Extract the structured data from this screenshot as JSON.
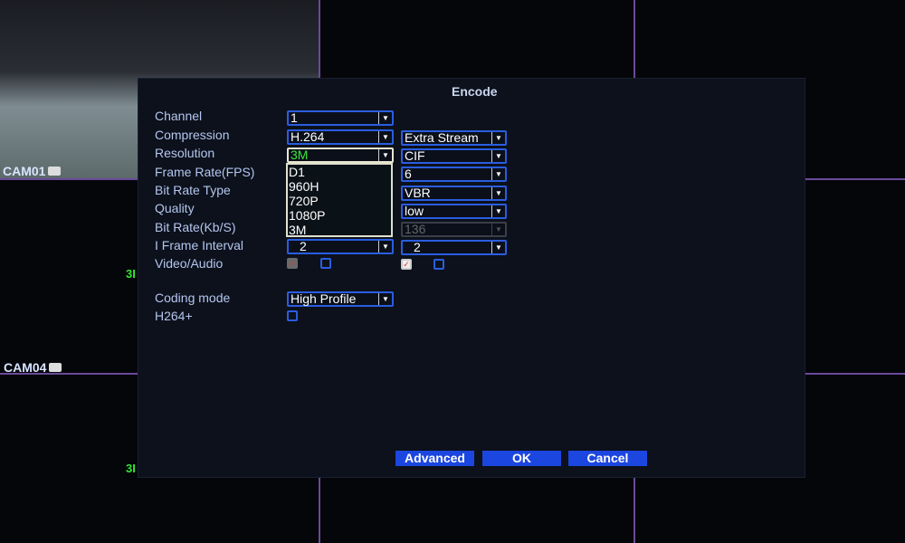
{
  "cameras": {
    "cam01": "CAM01",
    "cam04": "CAM04"
  },
  "fragments": {
    "a": "3I",
    "b": "3I"
  },
  "dialog": {
    "title": "Encode",
    "labels": [
      "Channel",
      "Compression",
      "Resolution",
      "Frame Rate(FPS)",
      "Bit Rate Type",
      "Quality",
      "Bit Rate(Kb/S)",
      "I Frame Interval",
      "Video/Audio",
      "Coding mode",
      "H264+"
    ],
    "main": {
      "channel": "1",
      "compression": "H.264",
      "resolution": "3M",
      "iframe": "2",
      "coding_mode": "High Profile",
      "video": true,
      "audio": false,
      "h264plus": false
    },
    "extra": {
      "stream": "Extra Stream",
      "resolution": "CIF",
      "fps": "6",
      "bitrate_type": "VBR",
      "quality": "low",
      "bitrate": "136",
      "iframe": "2",
      "video": true,
      "audio": false
    },
    "resolution_options": [
      "D1",
      "960H",
      "720P",
      "1080P",
      "3M"
    ],
    "buttons": {
      "advanced": "Advanced",
      "ok": "OK",
      "cancel": "Cancel"
    }
  },
  "colors": {
    "accent": "#1c46e0",
    "selected_text": "#38e838",
    "grid": "#6a4a9a"
  }
}
